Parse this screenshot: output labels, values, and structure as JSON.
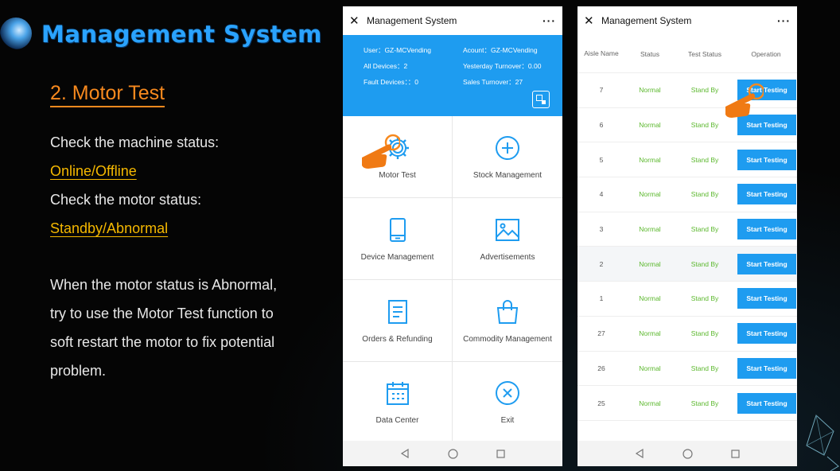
{
  "slide": {
    "title": "Management System",
    "section_title": "2. Motor Test",
    "desc": {
      "line1": "Check the machine status:",
      "line2": "Online/Offline",
      "line3": "Check the motor status:",
      "line4": "Standby/Abnormal",
      "para": [
        "When the motor status is Abnormal,",
        "try to use the Motor Test function to",
        "soft restart the motor to fix potential",
        "problem."
      ]
    }
  },
  "phone_left": {
    "title": "Management System",
    "more": "···",
    "info": {
      "user": "User：GZ-MCVending",
      "account": "Acount：GZ-MCVending",
      "all_devices": "All Devices：2",
      "yesterday_turnover": "Yesterday Turnover：0.00",
      "fault_devices": "Fault Devices：：0",
      "sales_turnover": "Sales Turnover：27"
    },
    "menu": [
      {
        "label": "Motor Test",
        "icon": "gear-icon"
      },
      {
        "label": "Stock Management",
        "icon": "plus-circle-icon"
      },
      {
        "label": "Device Management",
        "icon": "phone-device-icon"
      },
      {
        "label": "Advertisements",
        "icon": "image-icon"
      },
      {
        "label": "Orders & Refunding",
        "icon": "document-icon"
      },
      {
        "label": "Commodity Management",
        "icon": "shopping-bag-icon"
      },
      {
        "label": "Data Center",
        "icon": "calendar-icon"
      },
      {
        "label": "Exit",
        "icon": "close-circle-icon"
      }
    ]
  },
  "phone_right": {
    "title": "Management System",
    "more": "···",
    "headers": {
      "aisle": "Aisle Name",
      "status": "Status",
      "test_status": "Test Status",
      "operation": "Operation"
    },
    "rows": [
      {
        "aisle": "7",
        "status": "Normal",
        "test_status": "Stand By",
        "action": "Start Testing"
      },
      {
        "aisle": "6",
        "status": "Normal",
        "test_status": "Stand By",
        "action": "Start Testing"
      },
      {
        "aisle": "5",
        "status": "Normal",
        "test_status": "Stand By",
        "action": "Start Testing"
      },
      {
        "aisle": "4",
        "status": "Normal",
        "test_status": "Stand By",
        "action": "Start Testing"
      },
      {
        "aisle": "3",
        "status": "Normal",
        "test_status": "Stand By",
        "action": "Start Testing"
      },
      {
        "aisle": "2",
        "status": "Normal",
        "test_status": "Stand By",
        "action": "Start Testing"
      },
      {
        "aisle": "1",
        "status": "Normal",
        "test_status": "Stand By",
        "action": "Start Testing"
      },
      {
        "aisle": "27",
        "status": "Normal",
        "test_status": "Stand By",
        "action": "Start Testing"
      },
      {
        "aisle": "26",
        "status": "Normal",
        "test_status": "Stand By",
        "action": "Start Testing"
      },
      {
        "aisle": "25",
        "status": "Normal",
        "test_status": "Stand By",
        "action": "Start Testing"
      }
    ]
  },
  "colors": {
    "accent_blue": "#1e9cf0",
    "title_blue": "#2aa3ff",
    "orange": "#f7891e",
    "link_yellow": "#f5b800",
    "status_green": "#5cb82e"
  }
}
